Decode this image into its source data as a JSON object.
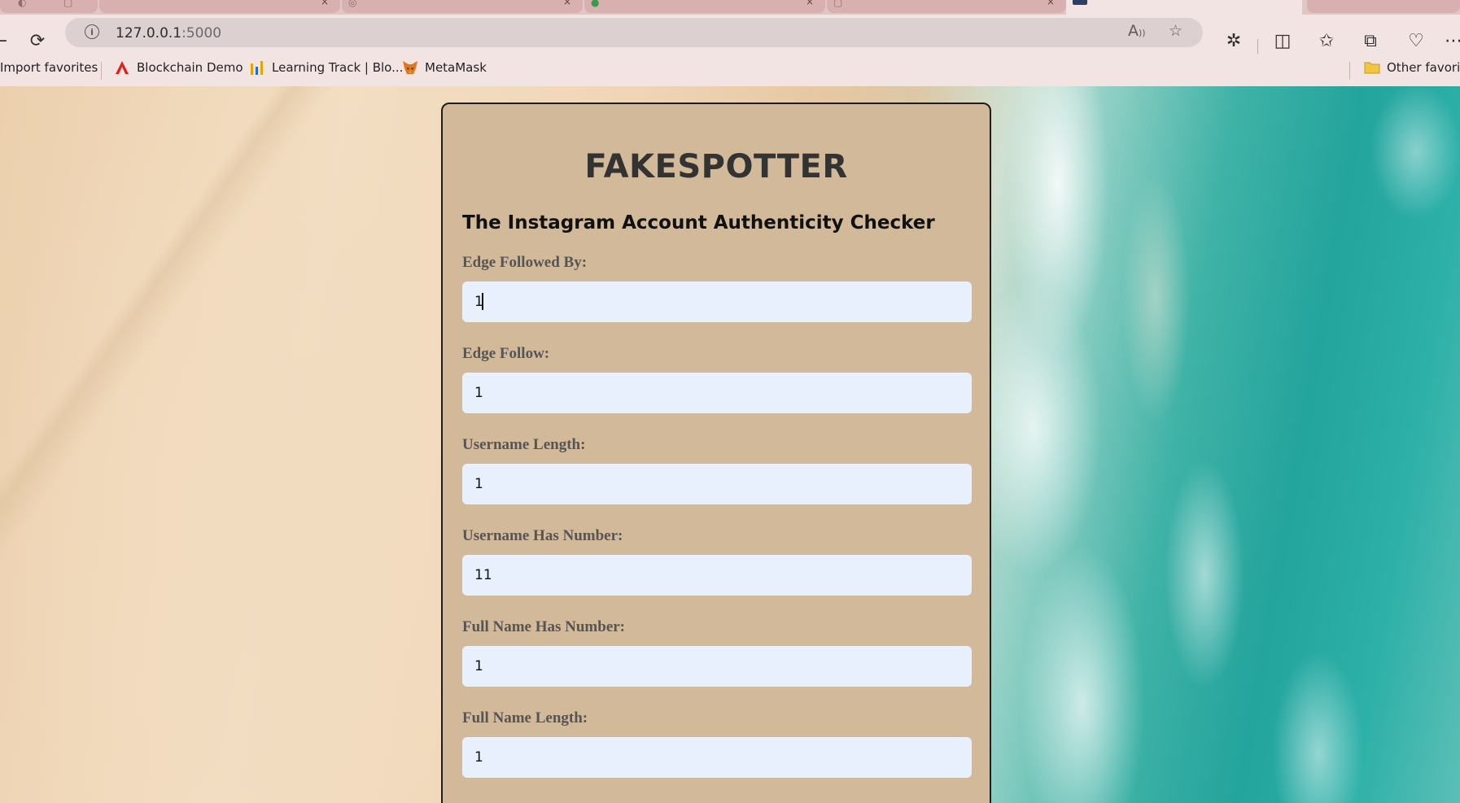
{
  "browser": {
    "address": {
      "host": "127.0.0.1",
      "port": ":5000"
    },
    "bookmarks": [
      {
        "label": "Import favorites",
        "icon": "import-icon"
      },
      {
        "label": "Blockchain Demo",
        "icon": "blockchain-demo-logo-icon"
      },
      {
        "label": "Learning Track | Blo...",
        "icon": "learning-track-logo-icon"
      },
      {
        "label": "MetaMask",
        "icon": "metamask-fox-icon"
      }
    ],
    "other_favorites": "Other favorite"
  },
  "page": {
    "title": "FAKESPOTTER",
    "subtitle": "The Instagram Account Authenticity Checker",
    "fields": [
      {
        "label": "Edge Followed By:",
        "value": "1"
      },
      {
        "label": "Edge Follow:",
        "value": "1"
      },
      {
        "label": "Username Length:",
        "value": "1"
      },
      {
        "label": "Username Has Number:",
        "value": "11"
      },
      {
        "label": "Full Name Has Number:",
        "value": "1"
      },
      {
        "label": "Full Name Length:",
        "value": "1"
      }
    ],
    "colors": {
      "card_background": "#d2b99a",
      "input_background": "#e8f0fe",
      "title_text": "#333333"
    }
  }
}
